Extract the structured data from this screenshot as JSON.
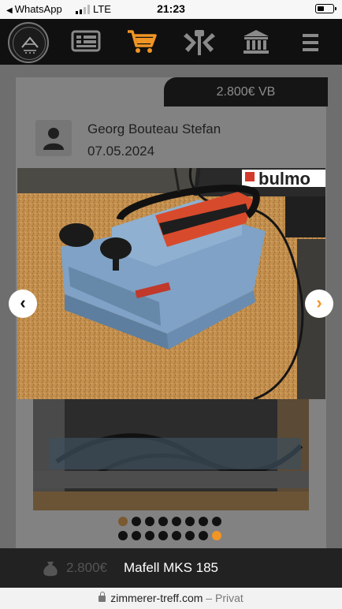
{
  "status_bar": {
    "back_app": "WhatsApp",
    "network": "LTE",
    "time": "21:23"
  },
  "nav": {
    "icons": [
      "logo-icon",
      "list-icon",
      "cart-icon",
      "tools-icon",
      "bank-icon",
      "menu-icon"
    ],
    "active_icon": "cart-icon",
    "accent_color": "#f19524",
    "close_label": "✕"
  },
  "listing": {
    "price": "2.800€ VB",
    "seller_name": "Georg Bouteau Stefan",
    "date": "07.05.2024"
  },
  "lightbox": {
    "prev_label": "‹",
    "next_label": "›",
    "photo_brand_text": "bulmo",
    "image_count": 16,
    "current_index": 16
  },
  "caption": {
    "price": "2.800€",
    "title": "Mafell MKS 185"
  },
  "url_bar": {
    "domain": "zimmerer-treff.com",
    "separator": "–",
    "mode": "Privat"
  }
}
